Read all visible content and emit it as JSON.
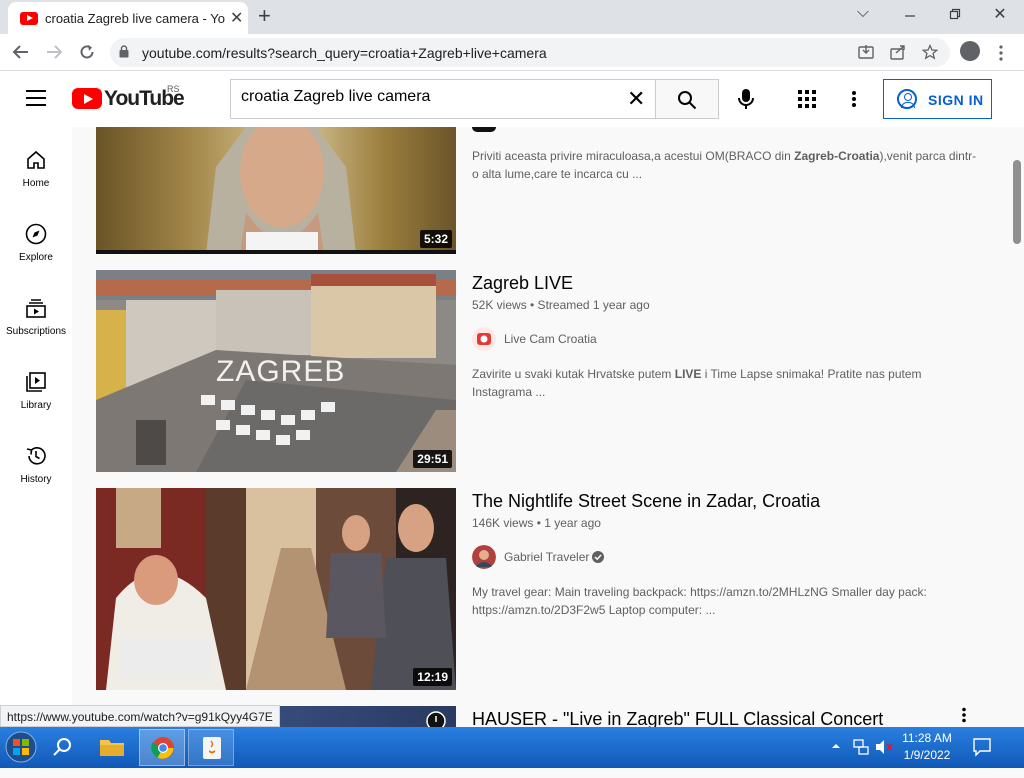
{
  "browser": {
    "tab_title": "croatia Zagreb live camera - YouTube",
    "tab_close": "✕",
    "new_tab": "+",
    "url": "youtube.com/results?search_query=croatia+Zagreb+live+camera",
    "minimize": "⌵",
    "close": "✕"
  },
  "youtube": {
    "logo_text": "YouTube",
    "region": "RS",
    "search_value": "croatia Zagreb live camera",
    "search_clear": "✕",
    "signin_label": "SIGN IN"
  },
  "sidebar": {
    "items": [
      {
        "label": "Home",
        "icon": "home-icon"
      },
      {
        "label": "Explore",
        "icon": "compass-icon"
      },
      {
        "label": "Subscriptions",
        "icon": "subscriptions-icon"
      },
      {
        "label": "Library",
        "icon": "library-icon"
      },
      {
        "label": "History",
        "icon": "history-icon"
      }
    ]
  },
  "results": [
    {
      "duration": "5:32",
      "description_pre": "Priviti aceasta privire miraculoasa,a acestui OM(BRACO din ",
      "description_bold": "Zagreb-Croatia",
      "description_post": "),venit parca dintr-o alta lume,care te incarca cu ..."
    },
    {
      "title": "Zagreb LIVE",
      "meta": "52K views • Streamed 1 year ago",
      "channel": "Live Cam Croatia",
      "duration": "29:51",
      "thumb_overlay": "ZAGREB",
      "description_pre": "Zavirite u svaki kutak Hrvatske putem ",
      "description_bold": "LIVE",
      "description_post": " i Time Lapse snimaka! Pratite nas putem Instagrama ..."
    },
    {
      "title": "The Nightlife Street Scene in Zadar, Croatia",
      "meta": "146K views • 1 year ago",
      "channel": "Gabriel Traveler",
      "duration": "12:19",
      "description": "My travel gear: Main traveling backpack: https://amzn.to/2MHLzNG Smaller day pack: https://amzn.to/2D3F2w5 Laptop computer: ..."
    },
    {
      "title": "HAUSER - \"Live in Zagreb\" FULL Classical Concert"
    }
  ],
  "status_url": "https://www.youtube.com/watch?v=g91kQyy4G7E",
  "taskbar": {
    "time": "11:28 AM",
    "date": "1/9/2022"
  }
}
